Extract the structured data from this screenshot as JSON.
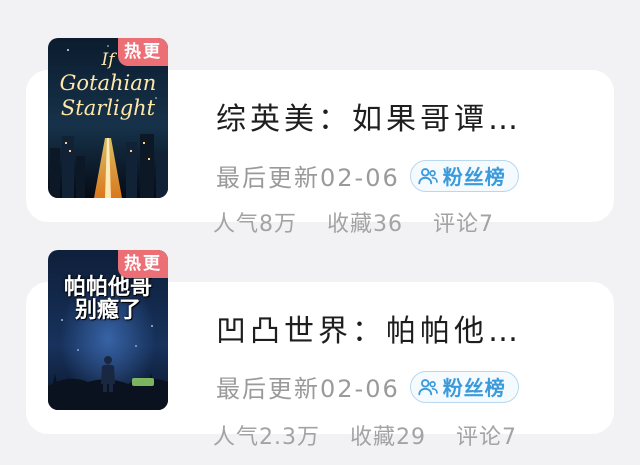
{
  "books": [
    {
      "badge": "热更",
      "cover_text": [
        "If",
        "Gotahian",
        "Starlight"
      ],
      "title": "综英美：如果哥谭…",
      "update": "最后更新02-06",
      "fan_label": "粉丝榜",
      "popularity": "人气8万",
      "favorites": "收藏36",
      "comments": "评论7"
    },
    {
      "badge": "热更",
      "cover_text": [
        "帕帕他哥",
        "别瘾了"
      ],
      "title": "凹凸世界：帕帕他…",
      "update": "最后更新02-06",
      "fan_label": "粉丝榜",
      "popularity": "人气2.3万",
      "favorites": "收藏29",
      "comments": "评论7"
    }
  ],
  "colors": {
    "background": "#f2f2f4",
    "badge": "#ec6f76",
    "fan_accent": "#3b9ad9",
    "muted_text": "#9a9a9a"
  },
  "icons": [
    "user-group-icon"
  ]
}
